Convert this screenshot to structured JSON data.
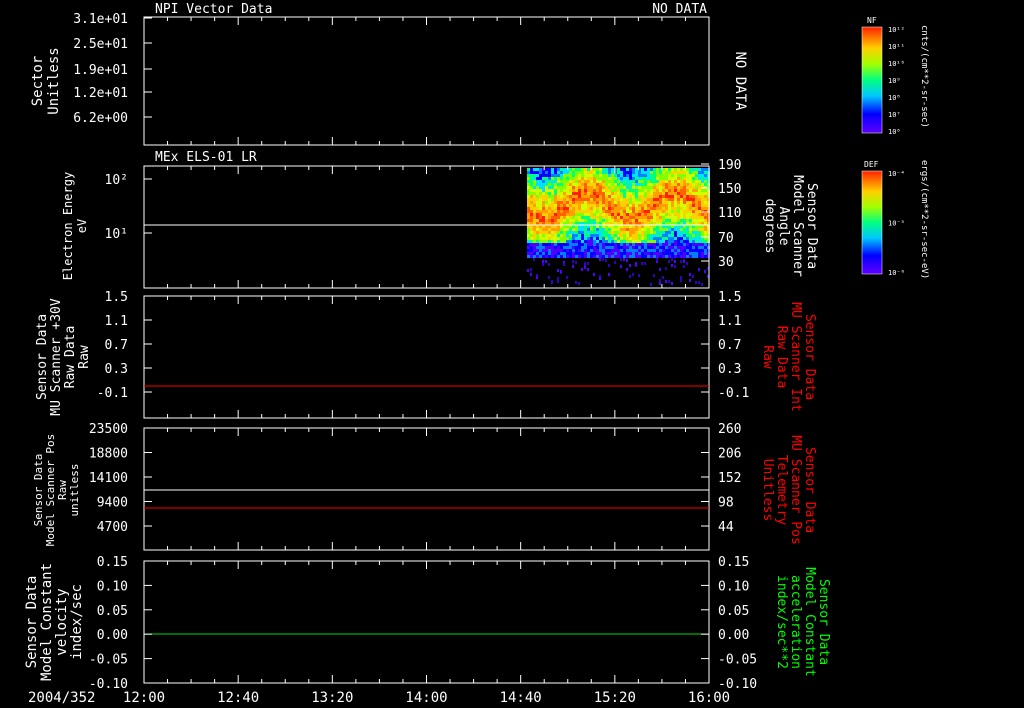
{
  "timeline": {
    "date_label": "2004/352",
    "ticks": [
      "12:00",
      "12:40",
      "13:20",
      "14:00",
      "14:40",
      "15:20",
      "16:00"
    ]
  },
  "panels": {
    "p1": {
      "title": "NPI Vector Data",
      "status": "NO DATA",
      "side_status": "NO DATA",
      "ylabel": [
        "Sector",
        "Unitless"
      ],
      "ticks": [
        "3.1e+01",
        "2.5e+01",
        "1.9e+01",
        "1.2e+01",
        "6.2e+00"
      ]
    },
    "p2": {
      "title": "MEx ELS-01 LR",
      "ylabel": [
        "Electron Energy",
        "eV"
      ],
      "ticks": [
        "10²",
        "10¹"
      ],
      "right_ticks": [
        "190",
        "150",
        "110",
        "70",
        "30"
      ],
      "right_label": [
        "Sensor Data",
        "Model Scanner",
        "Angle",
        "degrees"
      ]
    },
    "p3": {
      "ylabel": [
        "Sensor Data",
        "MU Scanner +30V",
        "Raw Data",
        "Raw"
      ],
      "ticks": [
        "1.5",
        "1.1",
        "0.7",
        "0.3",
        "-0.1"
      ],
      "right_ticks": [
        "1.5",
        "1.1",
        "0.7",
        "0.3",
        "-0.1"
      ],
      "right_label": [
        "Sensor Data",
        "MU Scanner Int",
        "Raw Data",
        "Raw"
      ]
    },
    "p4": {
      "ylabel": [
        "Sensor Data",
        "Model Scanner Pos",
        "Raw",
        "unitless"
      ],
      "ticks": [
        "23500",
        "18800",
        "14100",
        "9400",
        "4700"
      ],
      "right_ticks": [
        "260",
        "206",
        "152",
        "98",
        "44"
      ],
      "right_label": [
        "Sensor Data",
        "MU Scanner Pos",
        "Telemetry",
        "Unitless"
      ]
    },
    "p5": {
      "ylabel": [
        "Sensor Data",
        "Model Constant",
        "velocity",
        "index/sec"
      ],
      "ticks": [
        "0.15",
        "0.10",
        "0.05",
        "0.00",
        "-0.05",
        "-0.10"
      ],
      "right_ticks": [
        "0.15",
        "0.10",
        "0.05",
        "0.00",
        "-0.05",
        "-0.10"
      ],
      "right_label": [
        "Sensor Data",
        "Model Constant",
        "acceleration",
        "index/sec**2"
      ]
    }
  },
  "colorbars": {
    "nf": {
      "title": "NF",
      "unit": "cnts/(cm**2-sr-sec)",
      "ticks": [
        "10¹²",
        "10¹¹",
        "10¹⁰",
        "10⁹",
        "10⁸",
        "10⁷",
        "10⁶"
      ]
    },
    "def": {
      "title": "DEF",
      "unit": "ergs/(cm**2-sr-sec-eV)",
      "ticks": [
        "10⁻⁴",
        "10⁻⁵",
        "10⁻⁶"
      ]
    }
  },
  "colors": {
    "axis": "#ffffff",
    "red_trace": "#ff0000",
    "green_trace": "#00dd00",
    "red_label": "#ff0000",
    "green_label": "#00ff00"
  },
  "chart_data": [
    {
      "type": "line",
      "title": "NPI Vector Data",
      "note": "NO DATA",
      "yticks": [
        31,
        25,
        19,
        12,
        6.2
      ]
    },
    {
      "type": "heatmap",
      "title": "MEx ELS-01 LR",
      "x_range": [
        "14:13",
        "16:00"
      ],
      "ylabel": "Electron Energy eV",
      "log_y": true,
      "overlay_line": {
        "name": "Model Scanner Angle",
        "value": 85
      }
    },
    {
      "type": "line",
      "series": [
        {
          "name": "MU Scanner +30V",
          "values": [
            -0.03,
            -0.03
          ]
        }
      ],
      "x": [
        "12:00",
        "16:00"
      ],
      "ylim": [
        -0.3,
        1.5
      ]
    },
    {
      "type": "line",
      "series": [
        {
          "name": "Model Scanner Pos",
          "values": [
            11800,
            11800
          ]
        },
        {
          "name": "MU Scanner Pos",
          "values": [
            95,
            95
          ]
        }
      ],
      "x": [
        "12:00",
        "16:00"
      ]
    },
    {
      "type": "line",
      "series": [
        {
          "name": "Model Constant velocity",
          "values": [
            0,
            0
          ]
        },
        {
          "name": "Model Constant acceleration",
          "values": [
            0,
            0
          ]
        }
      ],
      "x": [
        "12:00",
        "16:00"
      ],
      "ylim": [
        -0.1,
        0.15
      ]
    }
  ]
}
